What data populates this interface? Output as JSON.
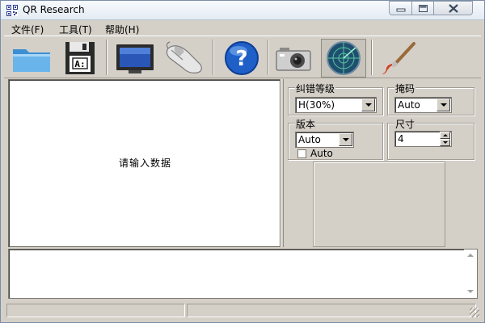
{
  "window": {
    "title": "QR Research"
  },
  "menu": {
    "items": [
      {
        "label": "文件(F)"
      },
      {
        "label": "工具(T)"
      },
      {
        "label": "帮助(H)"
      }
    ]
  },
  "toolbar": {
    "tools": [
      {
        "icon": "folder-icon"
      },
      {
        "icon": "save-disk-icon"
      },
      {
        "icon": "monitor-icon"
      },
      {
        "icon": "mouse-icon"
      },
      {
        "icon": "help-icon"
      },
      {
        "icon": "camera-icon"
      },
      {
        "icon": "radar-icon"
      },
      {
        "icon": "brush-icon"
      }
    ]
  },
  "input": {
    "prompt": "请输入数据"
  },
  "settings": {
    "ec_level": {
      "label": "纠错等级",
      "value": "H(30%)"
    },
    "mask": {
      "label": "掩码",
      "value": "Auto"
    },
    "version": {
      "label": "版本",
      "value": "Auto",
      "checkbox_label": "Auto"
    },
    "size": {
      "label": "尺寸",
      "value": "4"
    }
  },
  "colors": {
    "window_face": "#d4d0c8",
    "title_gradient_top": "#f7fafd",
    "title_gradient_bottom": "#e3ebf3"
  }
}
